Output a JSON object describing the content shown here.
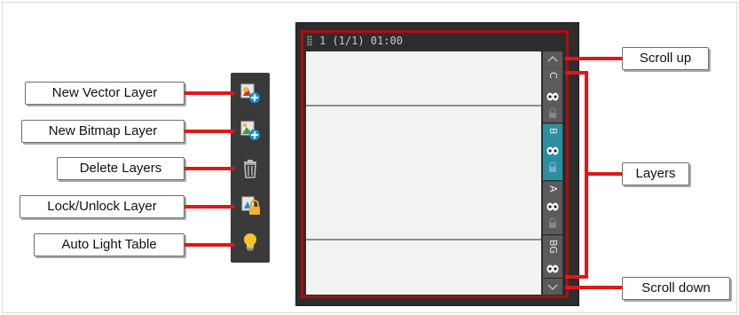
{
  "callouts": {
    "new_vector_layer": "New Vector Layer",
    "new_bitmap_layer": "New Bitmap Layer",
    "delete_layers": "Delete Layers",
    "lock_unlock_layer": "Lock/Unlock Layer",
    "auto_light_table": "Auto Light Table",
    "scroll_up": "Scroll up",
    "layers": "Layers",
    "scroll_down": "Scroll down"
  },
  "window": {
    "title": "1 (1/1) 01:00"
  },
  "layer_tabs": [
    {
      "label": "C",
      "active": false
    },
    {
      "label": "B",
      "active": true
    },
    {
      "label": "A",
      "active": false
    },
    {
      "label": "BG",
      "active": false
    }
  ],
  "colors": {
    "callout_line": "#e0171a",
    "window_border": "#b00d0d",
    "active_tab": "#2c8fa1",
    "toolbar_bg": "#3a3a3a"
  },
  "icons": {
    "toolbar": [
      "new-vector-layer-icon",
      "new-bitmap-layer-icon",
      "trash-icon",
      "lock-layer-icon",
      "light-bulb-icon"
    ],
    "scroll": [
      "chevron-up-icon",
      "chevron-down-icon"
    ]
  }
}
